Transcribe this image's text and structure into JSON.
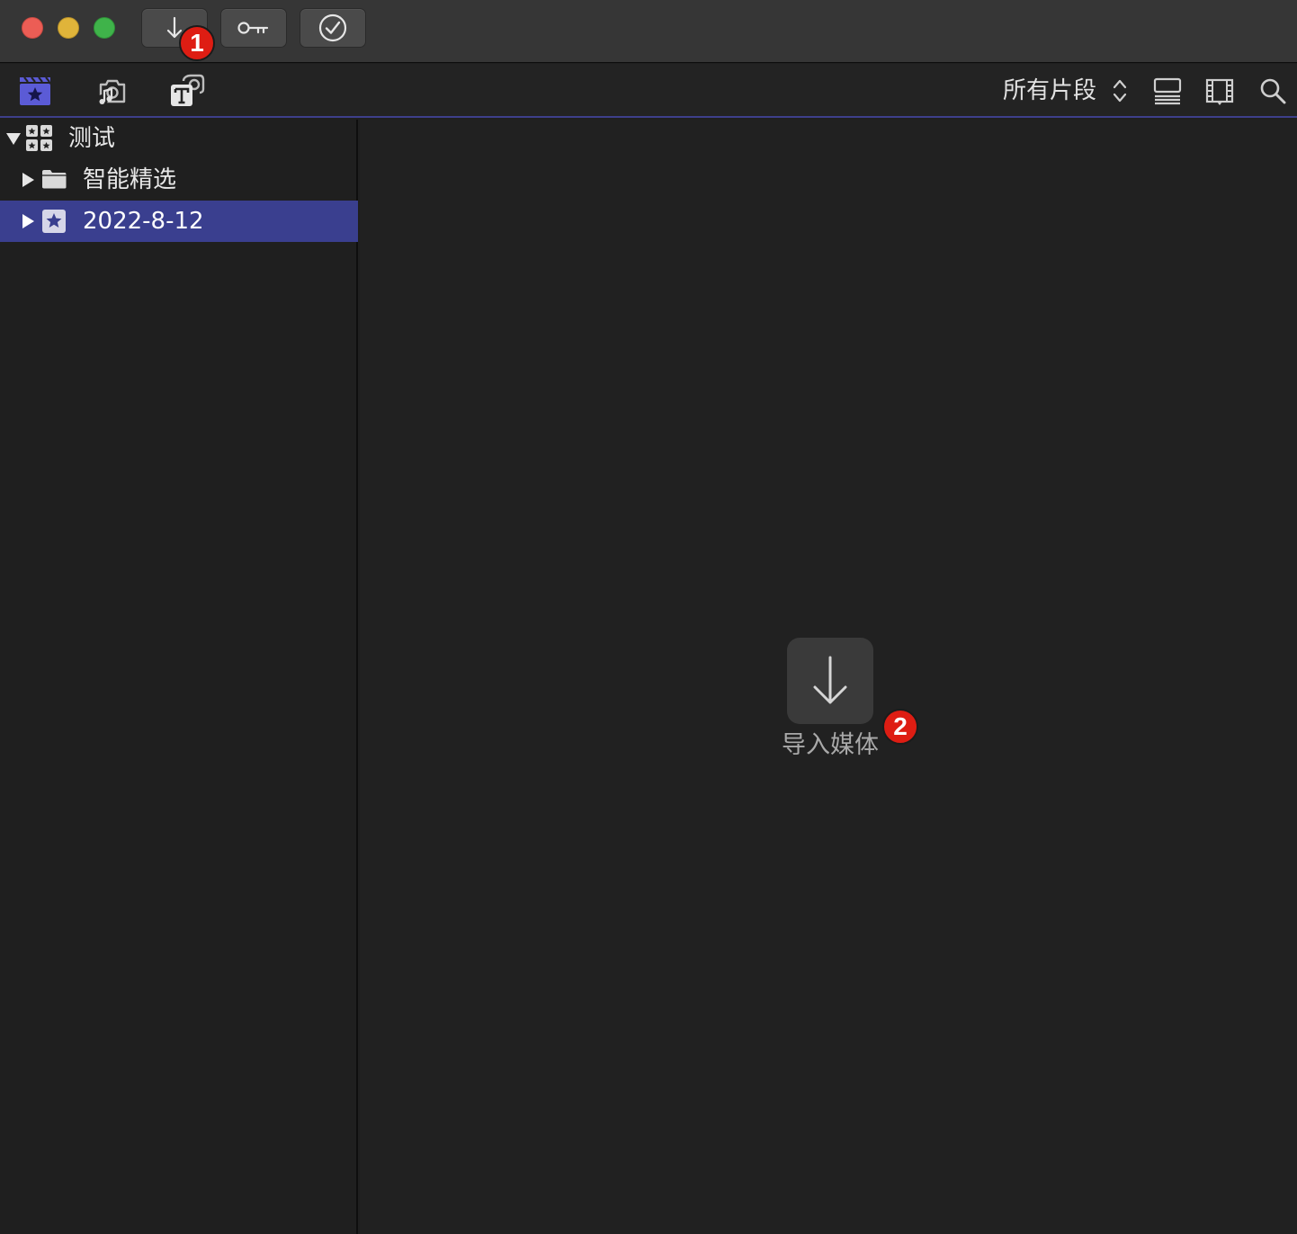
{
  "titlebar": {
    "badges": [
      "1",
      "2"
    ]
  },
  "toolbar": {
    "filter_label": "所有片段"
  },
  "sidebar": {
    "library": {
      "label": "测试"
    },
    "items": [
      {
        "label": "智能精选",
        "icon": "folder-icon"
      },
      {
        "label": "2022-8-12",
        "icon": "event-star-icon",
        "selected": true
      }
    ]
  },
  "browser": {
    "import_label": "导入媒体"
  },
  "colors": {
    "accent": "#3a3f8f",
    "badge": "#de1d13",
    "libraries_tab": "#5b5bd6"
  }
}
